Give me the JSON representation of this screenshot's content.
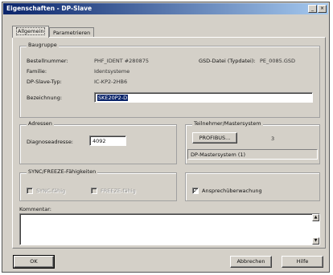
{
  "window": {
    "title": "Eigenschaften - DP-Slave",
    "minimize_glyph": "_",
    "close_glyph": "×"
  },
  "tabs": [
    {
      "label": "Allgemein",
      "active": true
    },
    {
      "label": "Parametrieren",
      "active": false
    }
  ],
  "baugruppe": {
    "group_label": "Baugruppe",
    "bestellnummer_label": "Bestellnummer:",
    "bestellnummer_value": "PHF_IDENT #280875",
    "familie_label": "Familie:",
    "familie_value": "Identsysteme",
    "slave_typ_label": "DP-Slave-Typ:",
    "slave_typ_value": "IC-KP2-2HB6",
    "gsd_label": "GSD-Datei (Typdatei):",
    "gsd_value": "PE_0085.GSD",
    "bezeichnung_label": "Bezeichnung:",
    "bezeichnung_value": "SKE20P2-D"
  },
  "adressen": {
    "group_label": "Adressen",
    "diagnose_label": "Diagnoseadresse:",
    "diagnose_value": "4092"
  },
  "teilnehmer": {
    "group_label": "Teilnehmer/Mastersystem",
    "profibus_button": "PROFIBUS...",
    "address_value": "3",
    "mastersystem_value": "DP-Mastersystem (1)"
  },
  "sync_freeze": {
    "group_label": "SYNC/FREEZE-Fähigkeiten",
    "sync_label": "SYNC-fähig",
    "freeze_label": "FREEZE-fähig"
  },
  "watchdog": {
    "label": "Ansprechüberwachung",
    "checked": true,
    "check_glyph": "✓"
  },
  "kommentar": {
    "label": "Kommentar:",
    "value": "",
    "scroll_up_glyph": "▲",
    "scroll_down_glyph": "▼"
  },
  "footer": {
    "ok_label": "OK",
    "abbrechen_label": "Abbrechen",
    "hilfe_label": "Hilfe"
  },
  "colors": {
    "titlebar_start": "#0a246a",
    "titlebar_end": "#a6caf0",
    "face": "#d4d0c8",
    "selection": "#0a246a"
  }
}
